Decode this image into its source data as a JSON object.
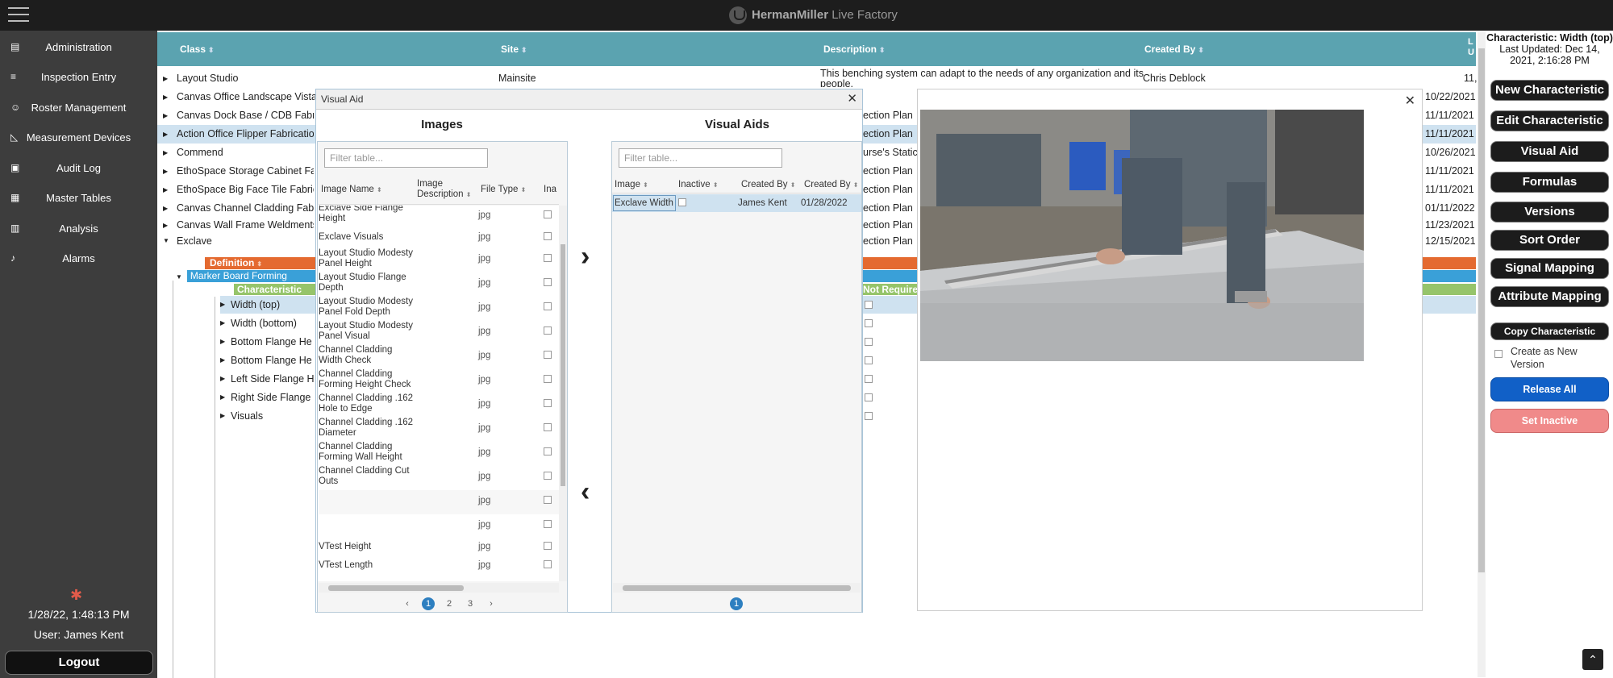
{
  "app": {
    "brand_herman": "HermanMiller",
    "brand_live": "Live Factory"
  },
  "sidebar": {
    "items": [
      {
        "label": "Administration",
        "icon": "document-icon"
      },
      {
        "label": "Inspection Entry",
        "icon": "list-icon"
      },
      {
        "label": "Roster Management",
        "icon": "add-user-icon"
      },
      {
        "label": "Measurement Devices",
        "icon": "ruler-icon"
      },
      {
        "label": "Audit Log",
        "icon": "log-icon"
      },
      {
        "label": "Master Tables",
        "icon": "table-icon"
      },
      {
        "label": "Analysis",
        "icon": "chart-icon"
      },
      {
        "label": "Alarms",
        "icon": "bell-icon"
      }
    ],
    "datetime": "1/28/22, 1:48:13 PM",
    "user": "User: James Kent",
    "logout": "Logout"
  },
  "table": {
    "headers": {
      "class": "Class",
      "site": "Site",
      "description": "Description",
      "created_by": "Created By",
      "last": "L\nU"
    },
    "rows": [
      {
        "cls": "Layout Studio",
        "site": "Mainsite",
        "desc": "This benching system can adapt to the needs of any organization and its people.",
        "created": "Chris Deblock",
        "date": "11,"
      },
      {
        "cls": "Canvas Office Landscape Vista",
        "site": "",
        "desc": "",
        "created": "",
        "date": "10/22/2021"
      },
      {
        "cls": "Canvas Dock Base / CDB Fabrica",
        "site": "",
        "desc": "ection Plan",
        "created": "",
        "date": "11/11/2021"
      },
      {
        "cls": "Action Office Flipper Fabrication",
        "site": "",
        "desc": "ection Plan",
        "created": "",
        "date": "11/11/2021"
      },
      {
        "cls": "Commend",
        "site": "",
        "desc": "urse's Static",
        "created": "",
        "date": "10/26/2021"
      },
      {
        "cls": "EthoSpace Storage Cabinet Fab",
        "site": "",
        "desc": "ection Plan",
        "created": "",
        "date": "11/11/2021"
      },
      {
        "cls": "EthoSpace Big Face Tile Fabricat",
        "site": "",
        "desc": "ection Plan",
        "created": "",
        "date": "11/11/2021"
      },
      {
        "cls": "Canvas Channel Cladding Fabric",
        "site": "",
        "desc": "ection Plan",
        "created": "",
        "date": "01/11/2022"
      },
      {
        "cls": "Canvas Wall Frame Weldments",
        "site": "",
        "desc": "ection Plan",
        "created": "",
        "date": "11/23/2021"
      },
      {
        "cls": "Exclave",
        "site": "",
        "desc": "ection Plan",
        "created": "",
        "date": "12/15/2021"
      }
    ],
    "definition_label": "Definition",
    "marker_board": "Marker Board Forming",
    "characteristic_label": "Characteristic",
    "not_required": "Not Require",
    "characteristics": [
      "Width (top)",
      "Width (bottom)",
      "Bottom Flange He",
      "Bottom Flange He",
      "Left Side Flange H",
      "Right Side Flange",
      "Visuals"
    ]
  },
  "modal": {
    "title": "Visual Aid",
    "images_title": "Images",
    "visual_aids_title": "Visual Aids",
    "filter_placeholder": "Filter table...",
    "image_headers": {
      "name": "Image Name",
      "desc": "Image Description",
      "type": "File Type",
      "inactive": "Ina"
    },
    "images": [
      {
        "name": "Exclave Side Flange Height",
        "type": "jpg"
      },
      {
        "name": "Exclave Visuals",
        "type": "jpg"
      },
      {
        "name": "Layout Studio Modesty Panel Height",
        "type": "jpg"
      },
      {
        "name": "Layout Studio Flange Depth",
        "type": "jpg"
      },
      {
        "name": "Layout Studio Modesty Panel Fold Depth",
        "type": "jpg"
      },
      {
        "name": "Layout Studio Modesty Panel Visual",
        "type": "jpg"
      },
      {
        "name": "Channel Cladding Width Check",
        "type": "jpg"
      },
      {
        "name": "Channel Cladding Forming Height Check",
        "type": "jpg"
      },
      {
        "name": "Channel Cladding .162 Hole to Edge",
        "type": "jpg"
      },
      {
        "name": "Channel Cladding .162 Diameter",
        "type": "jpg"
      },
      {
        "name": "Channel Cladding Forming Wall Height",
        "type": "jpg"
      },
      {
        "name": "Channel Cladding Cut Outs",
        "type": "jpg"
      },
      {
        "name": "",
        "type": "jpg"
      },
      {
        "name": "",
        "type": "jpg"
      },
      {
        "name": "VTest Height",
        "type": "jpg"
      },
      {
        "name": "VTest Length",
        "type": "jpg"
      }
    ],
    "pages": [
      "‹",
      "1",
      "2",
      "3",
      "›"
    ],
    "aid_headers": {
      "image": "Image",
      "inactive": "Inactive",
      "created_by": "Created By",
      "created_at": "Created By"
    },
    "aids": [
      {
        "image": "Exclave Width",
        "created_by": "James Kent",
        "date": "01/28/2022"
      }
    ],
    "aid_pages": [
      "1"
    ],
    "move_right": "›",
    "move_left": "‹"
  },
  "right_panel": {
    "title": "Characteristic: Width (top)",
    "updated": "Last Updated: Dec 14, 2021, 2:16:28 PM",
    "buttons": [
      "New Characteristic",
      "Edit Characteristic",
      "Visual Aid",
      "Formulas",
      "Versions",
      "Sort Order",
      "Signal Mapping",
      "Attribute Mapping"
    ],
    "copy": "Copy Characteristic",
    "create_new_version": "Create as New Version",
    "release_all": "Release All",
    "set_inactive": "Set Inactive"
  },
  "colors": {
    "header_teal": "#5ba3b0",
    "definition": "#e46a30",
    "marker": "#3aa0d8",
    "characteristic": "#96c46a",
    "release": "#1160c7",
    "inactive": "#f08a8a"
  }
}
